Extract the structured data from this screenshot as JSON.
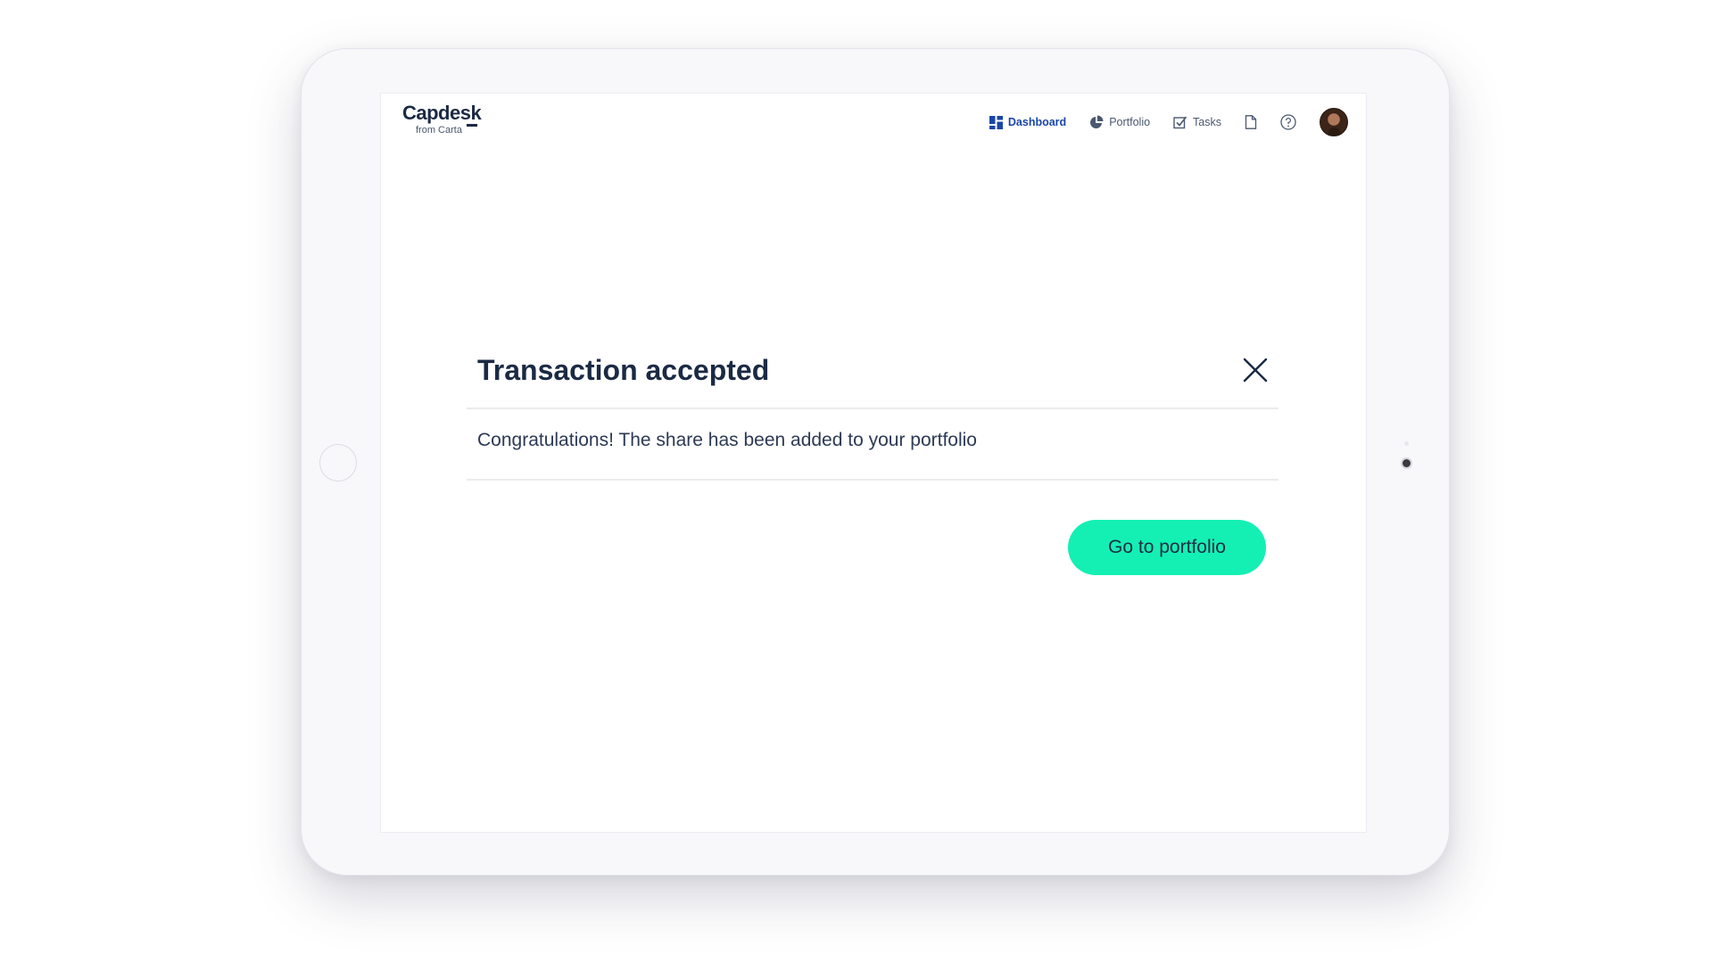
{
  "brand": {
    "name": "Capdesk",
    "subtitle": "from Carta"
  },
  "nav": {
    "items": [
      {
        "label": "Dashboard",
        "icon": "dashboard-grid-icon",
        "active": true
      },
      {
        "label": "Portfolio",
        "icon": "pie-chart-icon",
        "active": false
      },
      {
        "label": "Tasks",
        "icon": "checkbox-icon",
        "active": false
      }
    ],
    "icon_buttons": [
      "document-icon",
      "help-circle-icon"
    ],
    "avatar": "user-avatar"
  },
  "dialog": {
    "title": "Transaction accepted",
    "message": "Congratulations! The share has been added to your portfolio",
    "close_icon": "close-icon",
    "primary_button": "Go to portfolio"
  },
  "colors": {
    "brand_dark": "#1b2a44",
    "nav_active": "#1a46a8",
    "accent_button": "#14f0b4"
  }
}
